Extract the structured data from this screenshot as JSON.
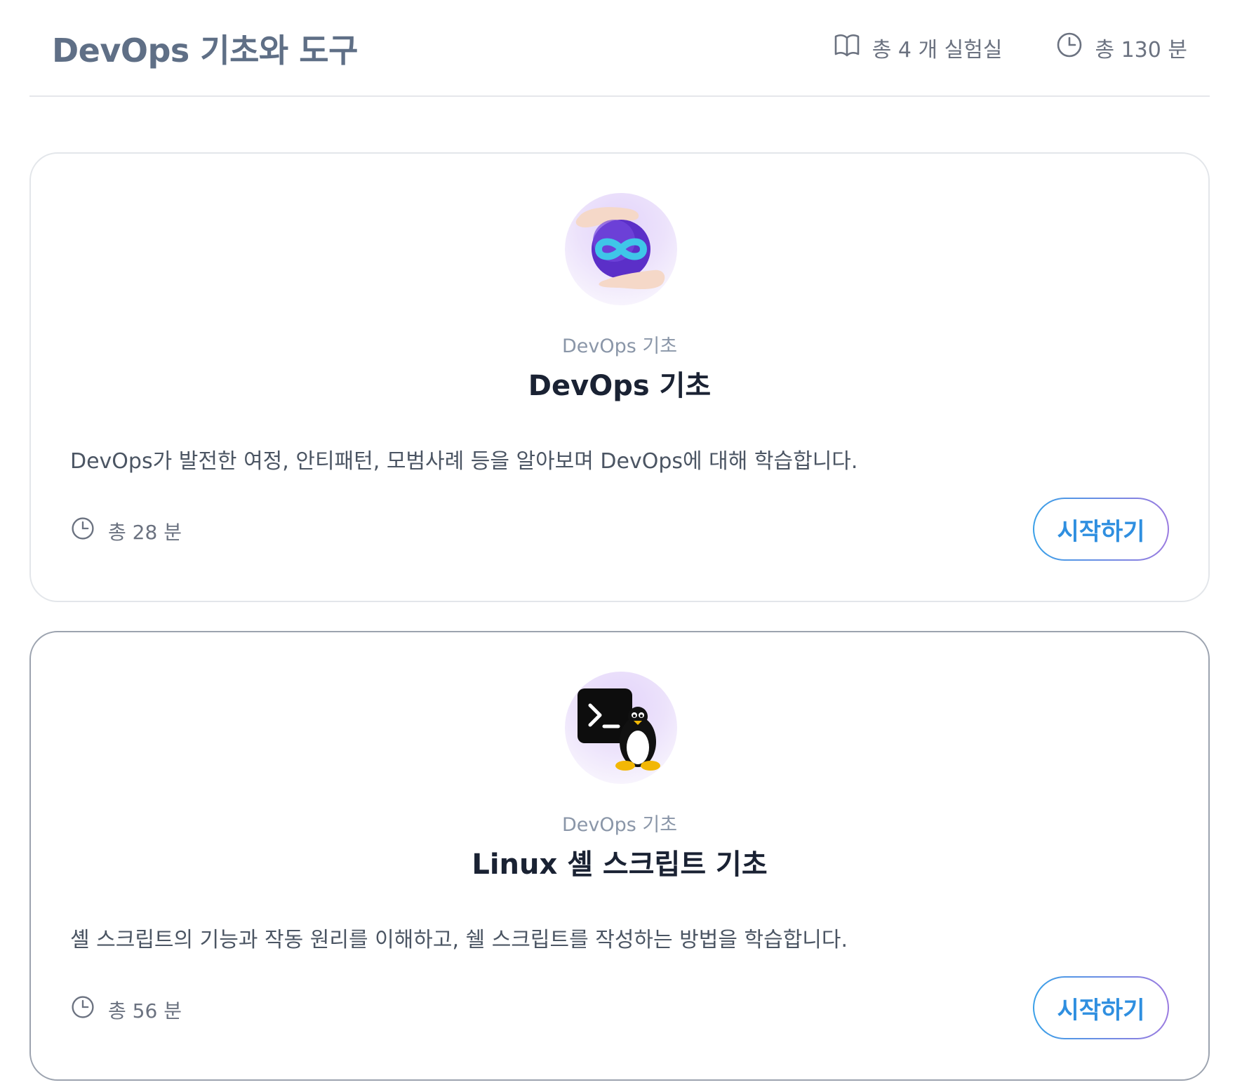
{
  "header": {
    "title": "DevOps 기초와 도구",
    "labs_count": "총 4 개 실험실",
    "total_time": "총 130 분",
    "icons": {
      "labs": "book-icon",
      "time": "clock-icon"
    }
  },
  "courses": [
    {
      "icon": "devops-infinity-icon",
      "category": "DevOps 기초",
      "title": "DevOps 기초",
      "description": "DevOps가 발전한 여정, 안티패턴, 모범사례 등을 알아보며 DevOps에 대해 학습합니다.",
      "duration": "총 28 분",
      "button_label": "시작하기"
    },
    {
      "icon": "linux-terminal-icon",
      "category": "DevOps 기초",
      "title": "Linux 셸 스크립트 기초",
      "description": "셸 스크립트의 기능과 작동 원리를 이해하고, 쉘 스크립트를 작성하는 방법을 학습합니다.",
      "duration": "총 56 분",
      "button_label": "시작하기"
    }
  ],
  "colors": {
    "header_title": "#5f6f86",
    "button_text": "#2f8fe0",
    "button_gradient_start": "#3aa0e8",
    "button_gradient_end": "#9b7be0",
    "thumb_bg": "#ece2fb"
  }
}
